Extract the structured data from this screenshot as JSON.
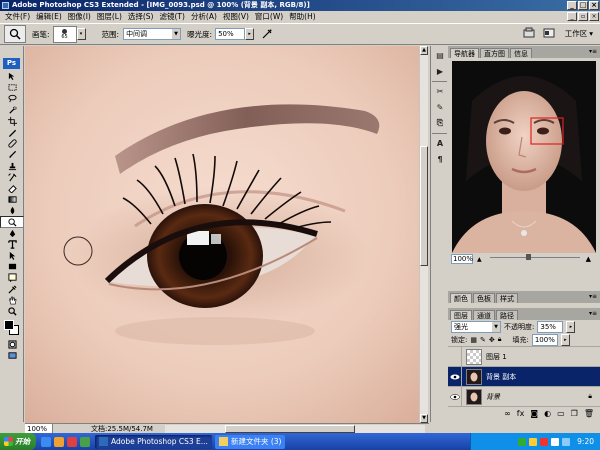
{
  "window": {
    "title": "Adobe Photoshop CS3 Extended - [IMG_0093.psd @ 100% (背景 副本, RGB/8)]"
  },
  "menu": [
    "文件(F)",
    "编辑(E)",
    "图像(I)",
    "图层(L)",
    "选择(S)",
    "滤镜(T)",
    "分析(A)",
    "视图(V)",
    "窗口(W)",
    "帮助(H)"
  ],
  "options": {
    "brush_label": "画笔:",
    "brush_size": "65",
    "range_label": "范围:",
    "range_value": "中间调",
    "exposure_label": "曝光度:",
    "exposure_value": "50%",
    "workspace_label": "工作区"
  },
  "canvas": {
    "doc_info": "文档:25.5M/54.7M"
  },
  "status": {
    "zoom": "100%"
  },
  "navigator": {
    "tabs": [
      "导航器",
      "直方图",
      "信息"
    ],
    "zoom": "100%"
  },
  "swatches_panel": {
    "tabs": [
      "颜色",
      "色板",
      "样式"
    ]
  },
  "layers_panel": {
    "tabs": [
      "图层",
      "通道",
      "路径"
    ],
    "blend_mode": "强光",
    "opacity_label": "不透明度:",
    "opacity_value": "35%",
    "lock_label": "锁定:",
    "fill_label": "填充:",
    "fill_value": "100%",
    "layers": [
      {
        "name": "图层 1",
        "selected": false
      },
      {
        "name": "背景 副本",
        "selected": true
      },
      {
        "name": "背景",
        "selected": false
      }
    ]
  },
  "taskbar": {
    "start": "开始",
    "tasks": [
      {
        "label": "Adobe Photoshop CS3 E...",
        "active": true
      },
      {
        "label": "新建文件夹 (3)",
        "active": false
      }
    ],
    "clock": "9:20"
  }
}
